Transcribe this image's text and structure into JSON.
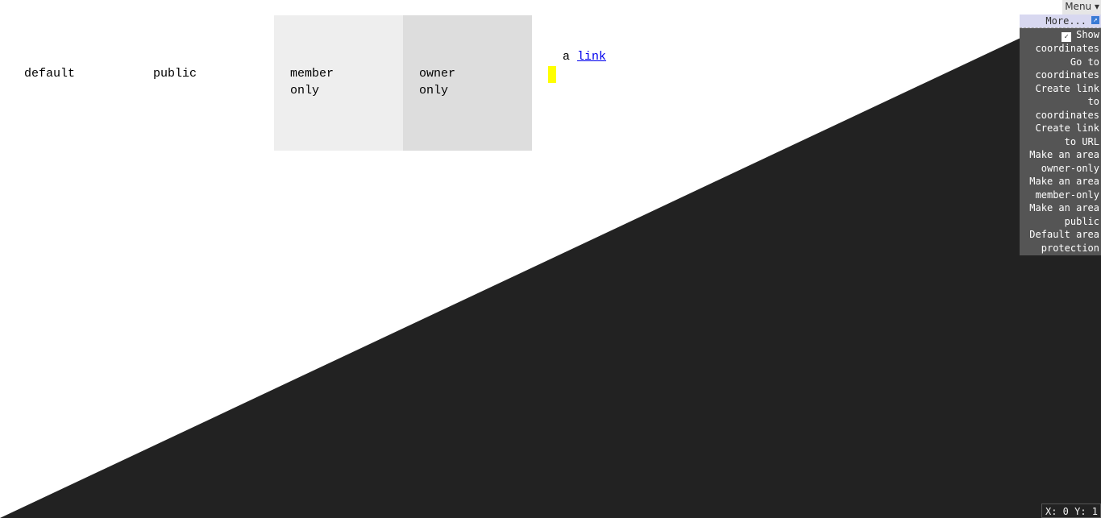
{
  "background": {
    "dark_color": "#222222",
    "light_color": "#ffffff"
  },
  "cells": {
    "default": "default",
    "public": "public",
    "member": "member only",
    "owner": "owner only",
    "link_prefix": "a ",
    "link_text": "link"
  },
  "menu": {
    "toggle_label": "Menu ▾",
    "header_label": "More...",
    "popout_icon": "popout-icon",
    "items": [
      {
        "label": "Show coordinates",
        "checked": true
      },
      {
        "label": "Go to coordinates"
      },
      {
        "label": "Create link to coordinates"
      },
      {
        "label": "Create link to URL"
      },
      {
        "label": "Make an area owner-only"
      },
      {
        "label": "Make an area member-only"
      },
      {
        "label": "Make an area public"
      },
      {
        "label": "Default area protection"
      }
    ]
  },
  "coordinates": "X: 0 Y: 1",
  "colors": {
    "member_bg": "#eeeeee",
    "owner_bg": "#dddddd",
    "cursor": "#ffff00",
    "menu_bg": "#555555",
    "link": "#0000ee"
  }
}
